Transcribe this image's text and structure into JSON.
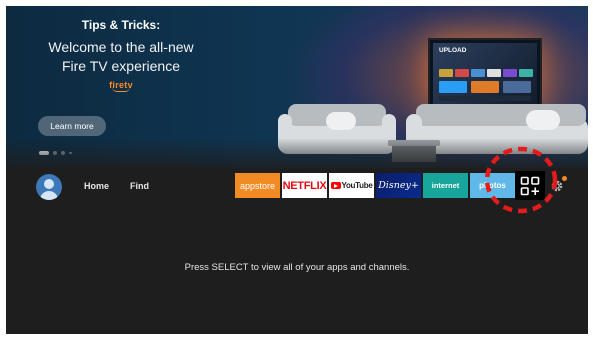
{
  "hero": {
    "eyebrow": "Tips & Tricks:",
    "headline_line1": "Welcome to the all-new",
    "headline_line2": "Fire TV experience",
    "brand": "firetv",
    "cta_label": "Learn more",
    "tv_title": "UPLOAD",
    "carousel": {
      "count": 4,
      "active_index": 0
    }
  },
  "nav": {
    "home_label": "Home",
    "find_label": "Find"
  },
  "apps": [
    {
      "id": "appstore",
      "label": "appstore"
    },
    {
      "id": "netflix",
      "label": "NETFLIX"
    },
    {
      "id": "youtube",
      "label": "YouTube"
    },
    {
      "id": "disney",
      "label": "Disney+"
    },
    {
      "id": "internet",
      "label": "internet"
    },
    {
      "id": "photos",
      "label": "photos"
    }
  ],
  "apps_button_icon": "apps-grid-plus-icon",
  "settings_icon": "gear-icon",
  "hint_text": "Press SELECT to view all of your apps and channels.",
  "colors": {
    "accent_orange": "#f28b24",
    "highlight_red": "#e31b1b",
    "screen_bg": "#1e1e1e"
  }
}
